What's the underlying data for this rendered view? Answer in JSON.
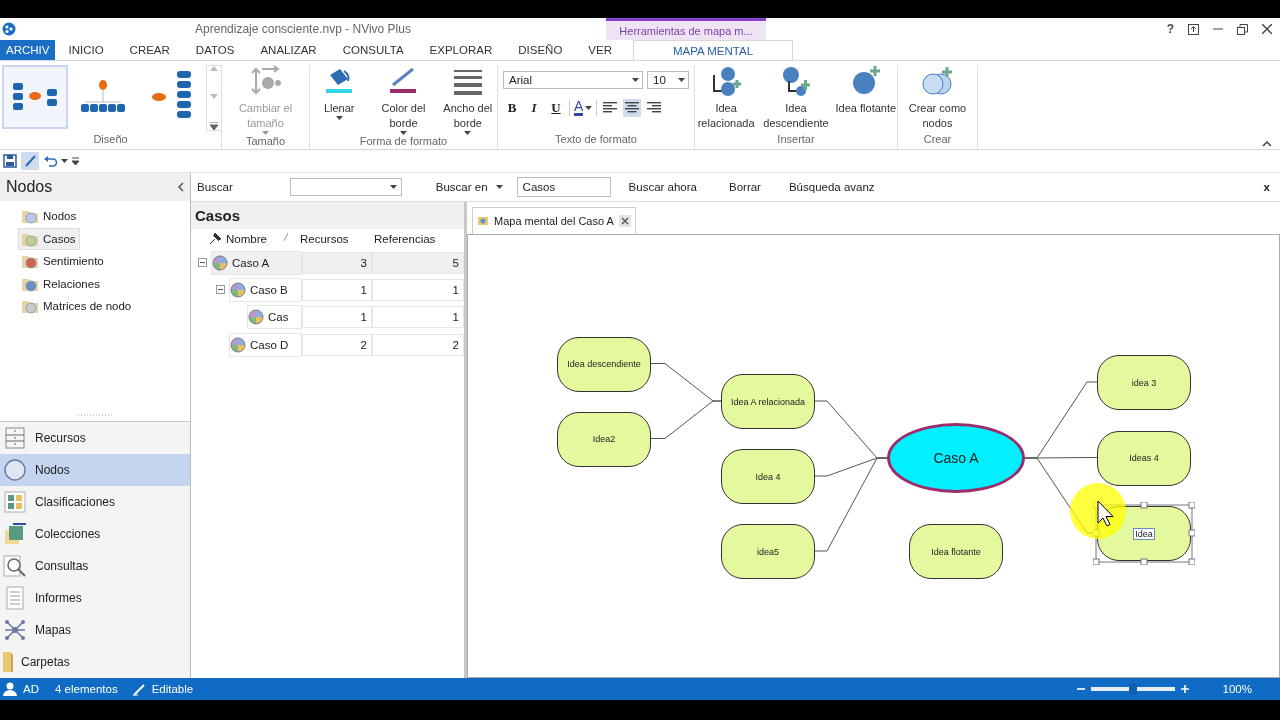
{
  "window": {
    "title": "Aprendizaje consciente.nvp - NVivo Plus",
    "context_group": "Herramientas de mapa m...",
    "help": "?"
  },
  "menu_tabs": [
    {
      "label": "ARCHIV",
      "kind": "file",
      "selected": false
    },
    {
      "label": "INICIO",
      "kind": "tab",
      "selected": false
    },
    {
      "label": "CREAR",
      "kind": "tab",
      "selected": false
    },
    {
      "label": "DATOS",
      "kind": "tab",
      "selected": false
    },
    {
      "label": "ANALIZAR",
      "kind": "tab",
      "selected": false
    },
    {
      "label": "CONSULTA",
      "kind": "tab",
      "selected": false
    },
    {
      "label": "EXPLORAR",
      "kind": "tab",
      "selected": false
    },
    {
      "label": "DISEÑO",
      "kind": "tab",
      "selected": false
    },
    {
      "label": "VER",
      "kind": "tab",
      "selected": false
    },
    {
      "label": "MAPA MENTAL",
      "kind": "context",
      "selected": true
    }
  ],
  "ribbon": {
    "groups": [
      {
        "label": "Diseño",
        "kind": "gallery",
        "layouts": [
          {
            "selected": true
          },
          {
            "selected": false
          },
          {
            "selected": false
          }
        ]
      },
      {
        "label": "Tamaño",
        "kind": "buttons",
        "buttons": [
          {
            "label": "Cambiar el tamaño",
            "disabled": true,
            "dropdown": true
          }
        ]
      },
      {
        "label": "Forma de formato",
        "kind": "buttons",
        "buttons": [
          {
            "label": "Llenar",
            "disabled": false,
            "dropdown": true
          },
          {
            "label": "Color del borde",
            "disabled": false,
            "dropdown": true
          },
          {
            "label": "Ancho del borde",
            "disabled": false,
            "dropdown": true
          }
        ]
      },
      {
        "label": "Texto de formato",
        "kind": "text",
        "font": "Arial",
        "size": "10",
        "styles": [
          "B",
          "I",
          "U"
        ],
        "font_color": "A",
        "align": [
          {
            "selected": false
          },
          {
            "selected": true
          },
          {
            "selected": false
          }
        ]
      },
      {
        "label": "Insertar",
        "kind": "buttons",
        "buttons": [
          {
            "label": "Idea relacionada",
            "disabled": false,
            "dropdown": false
          },
          {
            "label": "Idea descendiente",
            "disabled": false,
            "dropdown": false
          },
          {
            "label": "Idea flotante",
            "disabled": false,
            "dropdown": false
          }
        ]
      },
      {
        "label": "Crear",
        "kind": "buttons",
        "buttons": [
          {
            "label": "Crear como nodos",
            "disabled": false,
            "dropdown": false
          }
        ]
      }
    ]
  },
  "quick_access": {
    "edit_selected": true
  },
  "navigation": {
    "title": "Nodos",
    "items": [
      {
        "label": "Nodos",
        "selected": false
      },
      {
        "label": "Casos",
        "selected": true
      },
      {
        "label": "Sentimiento",
        "selected": false
      },
      {
        "label": "Relaciones",
        "selected": false
      },
      {
        "label": "Matrices de nodo",
        "selected": false
      }
    ],
    "sections": [
      {
        "label": "Recursos",
        "selected": false
      },
      {
        "label": "Nodos",
        "selected": true
      },
      {
        "label": "Clasificaciones",
        "selected": false
      },
      {
        "label": "Colecciones",
        "selected": false
      },
      {
        "label": "Consultas",
        "selected": false
      },
      {
        "label": "Informes",
        "selected": false
      },
      {
        "label": "Mapas",
        "selected": false
      },
      {
        "label": "Carpetas",
        "selected": false
      }
    ]
  },
  "find_bar": {
    "label": "Buscar",
    "search_in": "Buscar en",
    "scope": "Casos",
    "find_now": "Buscar ahora",
    "clear": "Borrar",
    "advanced": "Búsqueda avanz",
    "close": "x"
  },
  "case_list": {
    "title": "Casos",
    "columns": [
      "Nombre",
      "Recursos",
      "Referencias"
    ],
    "rows": [
      {
        "name": "Caso A",
        "resources": "3",
        "references": "5",
        "selected": true,
        "expanded": true,
        "children": [
          {
            "name": "Caso B",
            "resources": "1",
            "references": "1",
            "selected": false,
            "expanded": true,
            "children": [
              {
                "name": "Cas",
                "resources": "1",
                "references": "1",
                "selected": false
              }
            ]
          },
          {
            "name": "Caso D",
            "resources": "2",
            "references": "2",
            "selected": false
          }
        ]
      }
    ]
  },
  "document_tab": {
    "title": "Mapa mental del Caso A"
  },
  "mind_map": {
    "central": {
      "label": "Caso A"
    },
    "left": [
      {
        "label": "Idea A relacionada",
        "selected": false,
        "children": [
          {
            "label": "Idea descendiente",
            "selected": false
          },
          {
            "label": "Idea2",
            "selected": false
          }
        ]
      },
      {
        "label": "Idea 4",
        "selected": false
      },
      {
        "label": "idea5",
        "selected": false
      }
    ],
    "right": [
      {
        "label": "idea 3",
        "selected": false
      },
      {
        "label": "Ideas 4",
        "selected": false
      },
      {
        "label": "Idea",
        "selected": true
      }
    ],
    "floating": [
      {
        "label": "Idea flotante",
        "selected": false
      }
    ]
  },
  "status_bar": {
    "user": "AD",
    "items": "4 elementos",
    "mode": "Editable",
    "zoom": {
      "level": 0.5
    },
    "zoom_label": "100%"
  }
}
